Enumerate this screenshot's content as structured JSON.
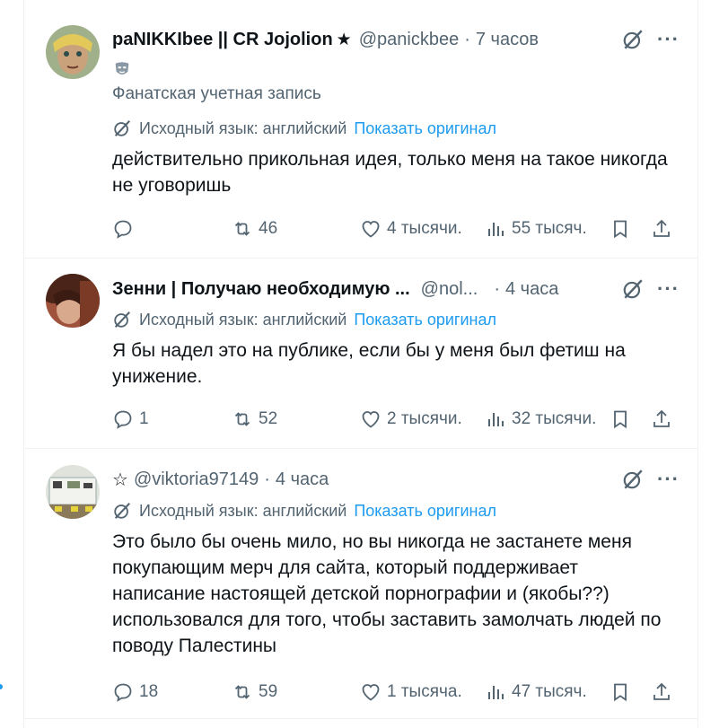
{
  "tweets": [
    {
      "name": "paNIKKIbee || CR Jojolion",
      "name_suffix": "★",
      "handle": "@panickbee",
      "separator": "·",
      "time": "7 часов",
      "label": "Фанатская учетная запись",
      "translate_note": "Исходный язык: английский",
      "show_original": "Показать оригинал",
      "text": "действительно прикольная идея, только меня на такое никогда не уговоришь",
      "replies": "",
      "retweets": "46",
      "likes": "4 тысячи.",
      "views": "55 тысяч."
    },
    {
      "name": "Зенни | Получаю необходимую ...",
      "handle": "@nol...",
      "separator": "·",
      "time": "4 часа",
      "translate_note": "Исходный язык: английский",
      "show_original": "Показать оригинал",
      "text": "Я бы надел это на публике, если бы у меня был фетиш на унижение.",
      "replies": "1",
      "retweets": "52",
      "likes": "2 тысячи.",
      "views": "32 тысячи."
    },
    {
      "name_prefix": "☆",
      "handle": "@viktoria97149",
      "separator": "·",
      "time": "4 часа",
      "translate_note": "Исходный язык: английский",
      "show_original": "Показать оригинал",
      "text": "Это было бы очень мило, но вы никогда не застанете меня покупающим мерч для сайта, который поддерживает написание настоящей детской порнографии и (якобы??) использовался для того, чтобы заставить замолчать людей по поводу Палестины",
      "replies": "18",
      "retweets": "59",
      "likes": "1 тысяча.",
      "views": "47 тысяч."
    }
  ],
  "icons": {
    "reply": "reply-icon",
    "retweet": "retweet-icon",
    "like": "heart-icon",
    "views": "views-icon",
    "bookmark": "bookmark-icon",
    "share": "share-icon",
    "grok": "grok-icon",
    "more": "more-icon",
    "translate": "translate-icon"
  },
  "colors": {
    "link": "#1d9bf0",
    "secondary": "#536471",
    "text": "#0f1419"
  }
}
